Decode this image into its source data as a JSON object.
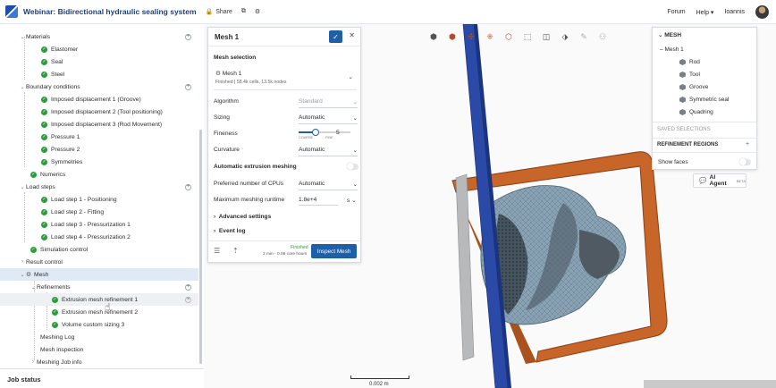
{
  "topbar": {
    "title": "Webinar: Bidirectional hydraulic sealing system",
    "share": "Share",
    "forum": "Forum",
    "help": "Help ▾",
    "user": "Ioannis"
  },
  "tree": {
    "materials": "Materials",
    "materials_items": [
      "Elastomer",
      "Seal",
      "Steel"
    ],
    "boundary_conditions": "Boundary conditions",
    "bc_items": [
      "Imposed displacement 1 (Groove)",
      "Imposed displacement 2 (Tool positioning)",
      "Imposed displacement 3 (Rod Movement)",
      "Pressure 1",
      "Pressure 2",
      "Symmetries"
    ],
    "numerics": "Numerics",
    "load_steps": "Load steps",
    "load_items": [
      "Load step 1 - Positioning",
      "Load step 2 - Fitting",
      "Load step 3 - Pressurization 1",
      "Load step 4 - Pressurization 2"
    ],
    "simulation_control": "Simulation control",
    "result_control": "Result control",
    "mesh": "Mesh",
    "refinements": "Refinements",
    "refinement_items": [
      "Extrusion mesh refinement 1",
      "Extrusion mesh refinement 2",
      "Volume custom sizing 3"
    ],
    "meshing_log": "Meshing Log",
    "mesh_inspection": "Mesh inspection",
    "meshing_job_info": "Meshing Job info",
    "job_status": "Job status"
  },
  "panel": {
    "title": "Mesh 1",
    "mesh_selection": "Mesh selection",
    "mesh_name": "Mesh 1",
    "mesh_status": "Finished | 58.4k cells, 13.5k nodes",
    "algorithm_label": "Algorithm",
    "algorithm_value": "Standard",
    "sizing_label": "Sizing",
    "sizing_value": "Automatic",
    "fineness_label": "Fineness",
    "fineness_value": "5",
    "fineness_fraction": 0.5,
    "coarse": "COARSE",
    "fine": "FINE",
    "curvature_label": "Curvature",
    "curvature_value": "Automatic",
    "auto_extrusion": "Automatic extrusion meshing",
    "cpus_label": "Preferred number of CPUs",
    "cpus_value": "Automatic",
    "runtime_label": "Maximum meshing runtime",
    "runtime_value": "1.8e+4",
    "runtime_unit": "s",
    "advanced": "Advanced settings",
    "event_log": "Event log",
    "finished": "Finished",
    "core_hours": "2 min - 0.06 core hours",
    "inspect_mesh": "Inspect Mesh"
  },
  "rpanel": {
    "mesh_header": "MESH",
    "mesh1": "Mesh 1",
    "parts": [
      "Rod",
      "Tool",
      "Groove",
      "Symmetric seal",
      "Quadring"
    ],
    "saved_selections": "SAVED SELECTIONS",
    "refinement_regions": "REFINEMENT REGIONS",
    "show_faces": "Show faces"
  },
  "ai_agent": {
    "label": "AI Agent",
    "badge": "BETA"
  },
  "scale": {
    "label": "0.002 m"
  },
  "colors": {
    "accent": "#1f5fa8",
    "check": "#2e9b3e",
    "rod": "#2b4aa8",
    "tool": "#c8662a"
  }
}
